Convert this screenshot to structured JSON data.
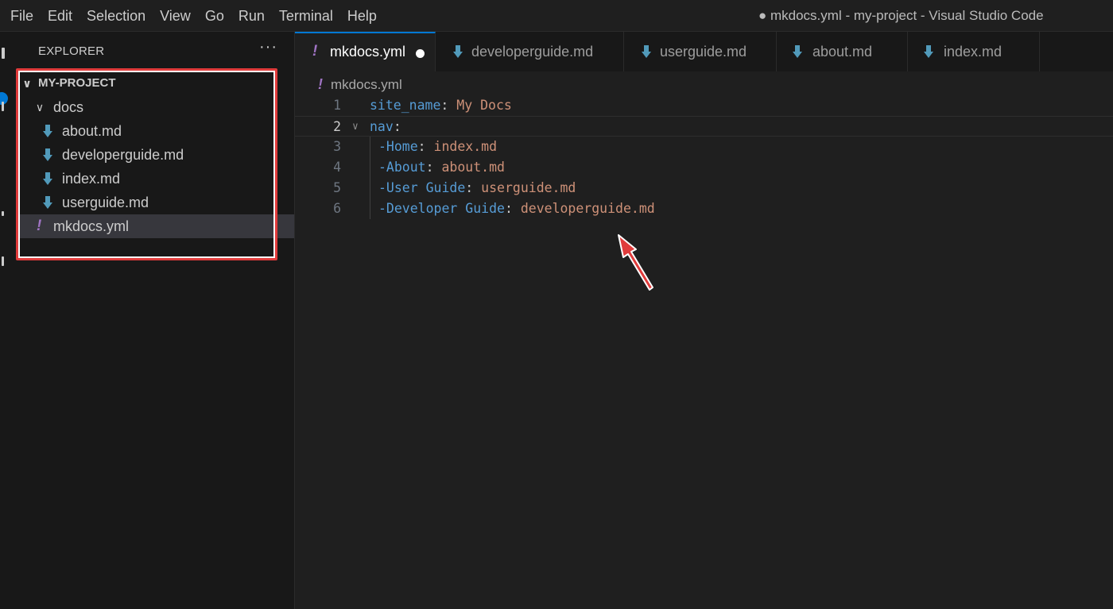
{
  "menu": [
    "File",
    "Edit",
    "Selection",
    "View",
    "Go",
    "Run",
    "Terminal",
    "Help"
  ],
  "window_title": "● mkdocs.yml - my-project - Visual Studio Code",
  "explorer": {
    "header": "EXPLORER",
    "more": "···",
    "project": "MY-PROJECT",
    "folder": "docs",
    "files": [
      "about.md",
      "developerguide.md",
      "index.md",
      "userguide.md"
    ],
    "root_file": "mkdocs.yml"
  },
  "tabs": [
    {
      "label": "mkdocs.yml",
      "type": "yml",
      "active": true,
      "dirty": true
    },
    {
      "label": "developerguide.md",
      "type": "md"
    },
    {
      "label": "userguide.md",
      "type": "md"
    },
    {
      "label": "about.md",
      "type": "md"
    },
    {
      "label": "index.md",
      "type": "md"
    }
  ],
  "breadcrumb": "mkdocs.yml",
  "yml_icon_glyph": "!",
  "editor": {
    "current_line": 2,
    "lines": [
      {
        "num": "1",
        "key": "site_name",
        "sep": ": ",
        "val": "My Docs"
      },
      {
        "num": "2",
        "key": "nav",
        "sep": ":",
        "val": ""
      },
      {
        "num": "3",
        "key": "-Home",
        "sep": ": ",
        "val": "index.md"
      },
      {
        "num": "4",
        "key": "-About",
        "sep": ": ",
        "val": "about.md"
      },
      {
        "num": "5",
        "key": "-User Guide",
        "sep": ": ",
        "val": "userguide.md"
      },
      {
        "num": "6",
        "key": "-Developer Guide",
        "sep": ": ",
        "val": "developerguide.md"
      }
    ]
  },
  "colors": {
    "yaml_key": "#569cd6",
    "yaml_value": "#ce9178",
    "annotation_red": "#e03b3b",
    "accent": "#0078d4",
    "md_icon": "#519aba",
    "yml_icon": "#a074c4"
  }
}
